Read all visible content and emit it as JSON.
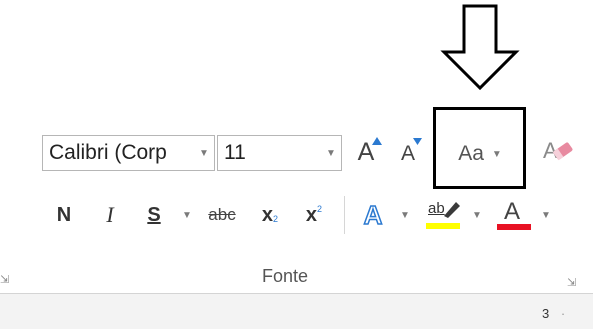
{
  "font_group": {
    "font_name": "Calibri (Corp",
    "font_size": "11",
    "grow_font_label": "A",
    "shrink_font_label": "A",
    "change_case_label": "Aa",
    "bold_label": "N",
    "italic_label": "I",
    "underline_label": "S",
    "strikethrough_label": "abc",
    "subscript_label": "x",
    "subscript_mark": "2",
    "superscript_label": "x",
    "superscript_mark": "2",
    "text_effects_label": "A",
    "highlight_label": "ab",
    "font_color_label": "A",
    "group_label": "Fonte",
    "highlight_color": "#ffff00",
    "font_color": "#e81123"
  },
  "status": {
    "page_number": "3"
  },
  "annotation": {
    "arrow_color": "#000000",
    "highlight_box_color": "#000000"
  }
}
